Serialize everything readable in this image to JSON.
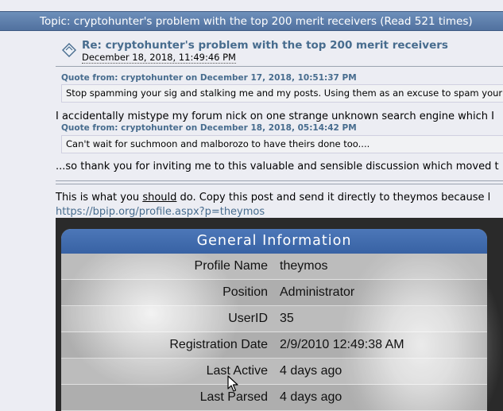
{
  "topic_bar": {
    "text": "Topic: cryptohunter's problem with the top 200 merit receivers  (Read 521 times)"
  },
  "post": {
    "title": "Re: cryptohunter's problem with the top 200 merit receivers",
    "date": "December 18, 2018, 11:49:46 PM"
  },
  "quotes": [
    {
      "header": "Quote from: cryptohunter on December 17, 2018, 10:51:37 PM",
      "text": "Stop spamming your sig and stalking me and my posts. Using them as an excuse to spam your s"
    },
    {
      "header": "Quote from: cryptohunter on December 18, 2018, 05:14:42 PM",
      "text": "Can't wait for suchmoon and malborozo to have theirs done too...."
    }
  ],
  "body": {
    "line1": "I accidentally mistype my forum nick on one strange unknown search engine which I",
    "line2": "...so thank you for inviting me to this valuable and sensible discussion which moved t",
    "line3_pre": "This is what you ",
    "line3_underlined": "should",
    "line3_post": " do. Copy this post and send it directly to theymos because l",
    "link": "https://bpip.org/profile.aspx?p=theymos"
  },
  "general_info": {
    "header": "General Information",
    "rows": [
      {
        "label": "Profile Name",
        "value": "theymos"
      },
      {
        "label": "Position",
        "value": "Administrator"
      },
      {
        "label": "UserID",
        "value": "35"
      },
      {
        "label": "Registration Date",
        "value": "2/9/2010 12:49:38 AM"
      },
      {
        "label": "Last Active",
        "value": "4 days ago"
      },
      {
        "label": "Last Parsed",
        "value": "4 days ago"
      }
    ]
  },
  "colors": {
    "topic_bar": "#5a7aa8",
    "link": "#476c8e",
    "gi_header": "#3f6aad"
  },
  "icons": {
    "post": "post-icon",
    "cursor": "mouse-pointer-icon"
  }
}
